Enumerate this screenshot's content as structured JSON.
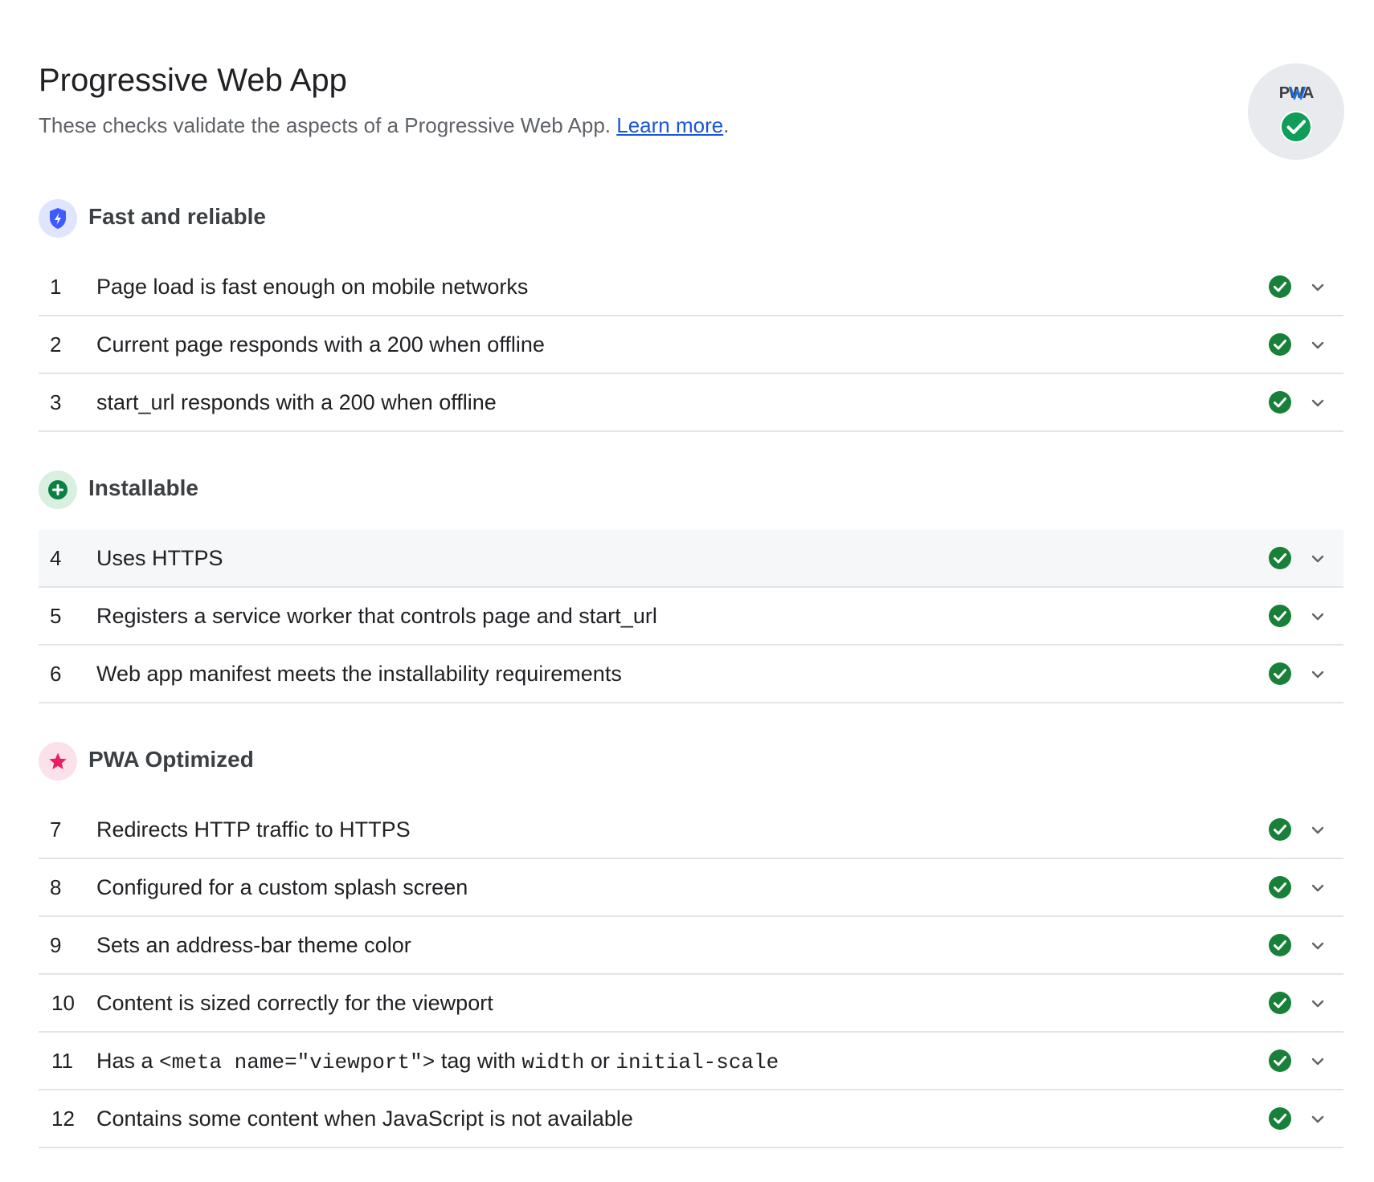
{
  "category": {
    "title": "Progressive Web App",
    "description": "These checks validate the aspects of a Progressive Web App.",
    "learn_more_label": "Learn more",
    "description_end": ".",
    "badge_label": "PWA",
    "status": "pass"
  },
  "colors": {
    "pass": "#188038",
    "link": "#1a57d6",
    "fast_icon": "#3d5afe",
    "installable_icon": "#0b8043",
    "optimized_icon": "#e91e63"
  },
  "groups": [
    {
      "title": "Fast and reliable",
      "icon": "shield-lightning-icon",
      "audits": [
        {
          "index": "1",
          "title": "Page load is fast enough on mobile networks",
          "status": "pass"
        },
        {
          "index": "2",
          "title": "Current page responds with a 200 when offline",
          "status": "pass"
        },
        {
          "index": "3",
          "title": "start_url responds with a 200 when offline",
          "status": "pass"
        }
      ]
    },
    {
      "title": "Installable",
      "icon": "plus-circle-icon",
      "audits": [
        {
          "index": "4",
          "title": "Uses HTTPS",
          "status": "pass"
        },
        {
          "index": "5",
          "title": "Registers a service worker that controls page and start_url",
          "status": "pass"
        },
        {
          "index": "6",
          "title": "Web app manifest meets the installability requirements",
          "status": "pass"
        }
      ]
    },
    {
      "title": "PWA Optimized",
      "icon": "star-icon",
      "audits": [
        {
          "index": "7",
          "title": "Redirects HTTP traffic to HTTPS",
          "status": "pass"
        },
        {
          "index": "8",
          "title": "Configured for a custom splash screen",
          "status": "pass"
        },
        {
          "index": "9",
          "title": "Sets an address-bar theme color",
          "status": "pass"
        },
        {
          "index": "10",
          "title": "Content is sized correctly for the viewport",
          "status": "pass"
        },
        {
          "index": "11",
          "title_parts": {
            "prefix": "Has a ",
            "code1": "<meta name=\"viewport\">",
            "middle": " tag with ",
            "code2": "width",
            "or": " or ",
            "code3": "initial-scale"
          },
          "status": "pass"
        },
        {
          "index": "12",
          "title": "Contains some content when JavaScript is not available",
          "status": "pass"
        }
      ]
    }
  ]
}
